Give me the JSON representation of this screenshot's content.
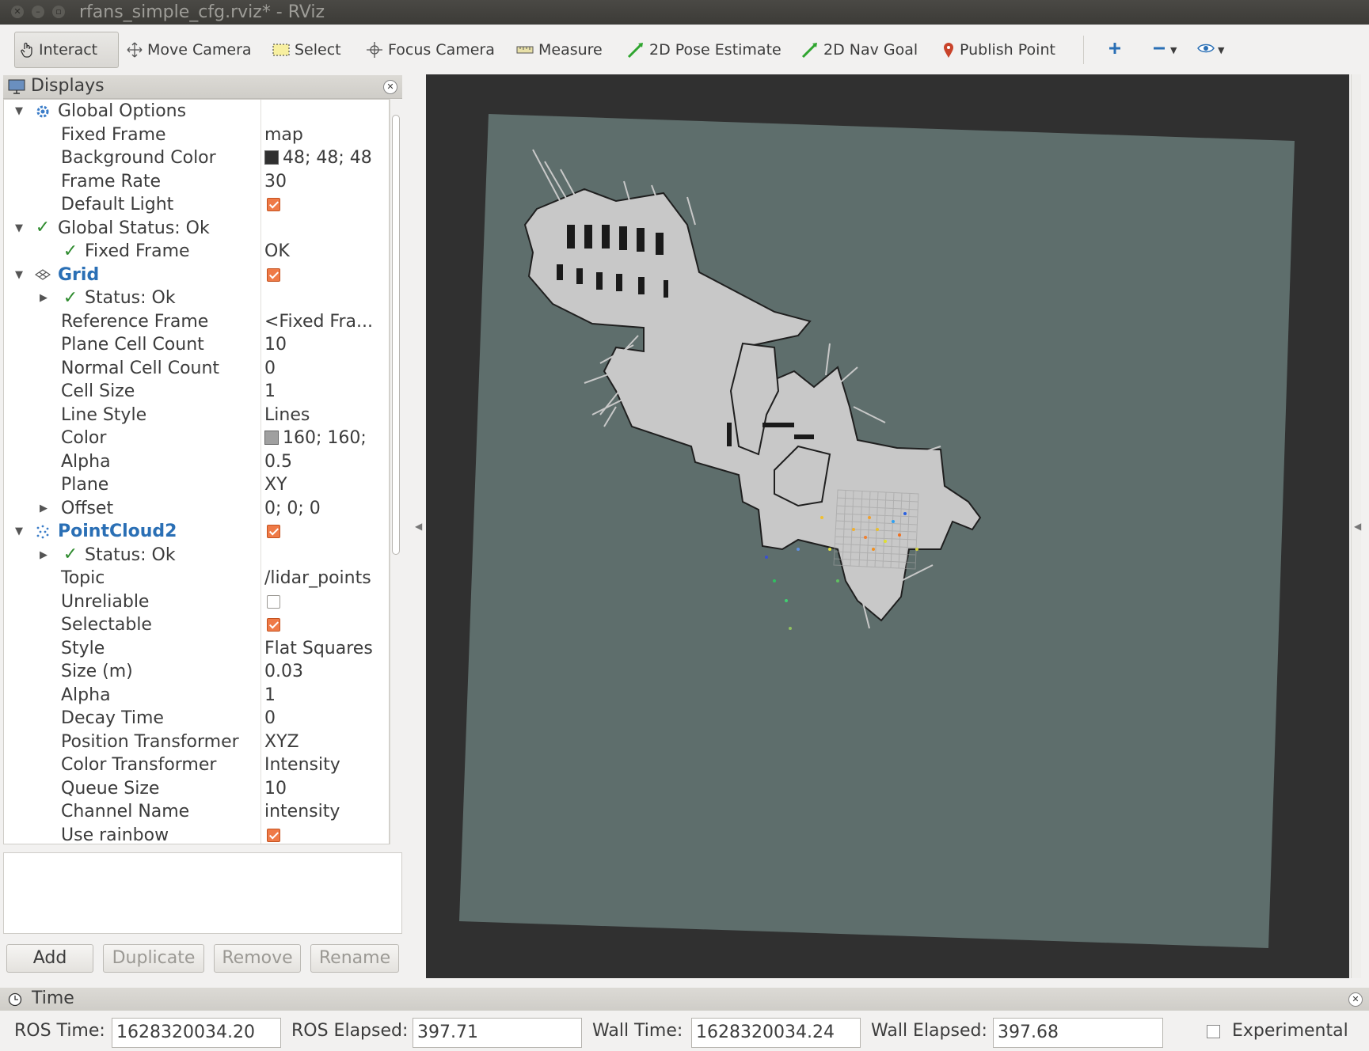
{
  "window": {
    "title": "rfans_simple_cfg.rviz* - RViz"
  },
  "toolbar": {
    "tools": [
      {
        "label": "Interact",
        "icon": "hand-icon"
      },
      {
        "label": "Move Camera",
        "icon": "move-camera-icon"
      },
      {
        "label": "Select",
        "icon": "select-icon"
      },
      {
        "label": "Focus Camera",
        "icon": "focus-camera-icon"
      },
      {
        "label": "Measure",
        "icon": "ruler-icon"
      },
      {
        "label": "2D Pose Estimate",
        "icon": "green-arrow-icon"
      },
      {
        "label": "2D Nav Goal",
        "icon": "green-arrow-icon"
      },
      {
        "label": "Publish Point",
        "icon": "location-pin-icon"
      }
    ],
    "active_tool": "Interact"
  },
  "displays_panel": {
    "title": "Displays",
    "rows": [
      {
        "name": "Global Options",
        "value": "",
        "level": 0,
        "expand": "open",
        "icon": "gear-icon"
      },
      {
        "name": "Fixed Frame",
        "value": "map",
        "level": 1
      },
      {
        "name": "Background Color",
        "value": "48; 48; 48",
        "level": 1,
        "swatch": "#303030"
      },
      {
        "name": "Frame Rate",
        "value": "30",
        "level": 1
      },
      {
        "name": "Default Light",
        "value": "",
        "level": 1,
        "checkbox": true
      },
      {
        "name": "Global Status: Ok",
        "value": "",
        "level": 0,
        "expand": "open",
        "icon": "checkmark-icon"
      },
      {
        "name": "Fixed Frame",
        "value": "OK",
        "level": 1,
        "status": true
      },
      {
        "name": "Grid",
        "value": "",
        "level": 0,
        "expand": "open",
        "icon": "grid-icon",
        "blue": true,
        "checkbox": true
      },
      {
        "name": "Status: Ok",
        "value": "",
        "level": 1,
        "expand": "closed",
        "status": true
      },
      {
        "name": "Reference Frame",
        "value": "<Fixed Fra...",
        "level": 1
      },
      {
        "name": "Plane Cell Count",
        "value": "10",
        "level": 1
      },
      {
        "name": "Normal Cell Count",
        "value": "0",
        "level": 1
      },
      {
        "name": "Cell Size",
        "value": "1",
        "level": 1
      },
      {
        "name": "Line Style",
        "value": "Lines",
        "level": 1
      },
      {
        "name": "Color",
        "value": "160; 160;",
        "level": 1,
        "swatch": "#a0a0a0"
      },
      {
        "name": "Alpha",
        "value": "0.5",
        "level": 1
      },
      {
        "name": "Plane",
        "value": "XY",
        "level": 1
      },
      {
        "name": "Offset",
        "value": "0; 0; 0",
        "level": 1,
        "expand": "closed"
      },
      {
        "name": "PointCloud2",
        "value": "",
        "level": 0,
        "expand": "open",
        "icon": "pointcloud-icon",
        "blue": true,
        "checkbox": true
      },
      {
        "name": "Status: Ok",
        "value": "",
        "level": 1,
        "expand": "closed",
        "status": true
      },
      {
        "name": "Topic",
        "value": "/lidar_points",
        "level": 1
      },
      {
        "name": "Unreliable",
        "value": "",
        "level": 1,
        "checkbox": false
      },
      {
        "name": "Selectable",
        "value": "",
        "level": 1,
        "checkbox": true
      },
      {
        "name": "Style",
        "value": "Flat Squares",
        "level": 1
      },
      {
        "name": "Size (m)",
        "value": "0.03",
        "level": 1
      },
      {
        "name": "Alpha",
        "value": "1",
        "level": 1
      },
      {
        "name": "Decay Time",
        "value": "0",
        "level": 1
      },
      {
        "name": "Position Transformer",
        "value": "XYZ",
        "level": 1
      },
      {
        "name": "Color Transformer",
        "value": "Intensity",
        "level": 1
      },
      {
        "name": "Queue Size",
        "value": "10",
        "level": 1
      },
      {
        "name": "Channel Name",
        "value": "intensity",
        "level": 1
      },
      {
        "name": "Use rainbow",
        "value": "",
        "level": 1,
        "checkbox": true
      }
    ],
    "buttons": {
      "add": "Add",
      "duplicate": "Duplicate",
      "remove": "Remove",
      "rename": "Rename"
    }
  },
  "view": {
    "background": "#303030",
    "map_plane_color": "#5e6e6c",
    "map_free_color": "#c8c8c8",
    "map_wall_color": "#1a1a1a"
  },
  "time_panel": {
    "title": "Time",
    "ros_time_label": "ROS Time:",
    "ros_time": "1628320034.20",
    "ros_elapsed_label": "ROS Elapsed:",
    "ros_elapsed": "397.71",
    "wall_time_label": "Wall Time:",
    "wall_time": "1628320034.24",
    "wall_elapsed_label": "Wall Elapsed:",
    "wall_elapsed": "397.68",
    "experimental_label": "Experimental",
    "experimental_checked": false
  }
}
